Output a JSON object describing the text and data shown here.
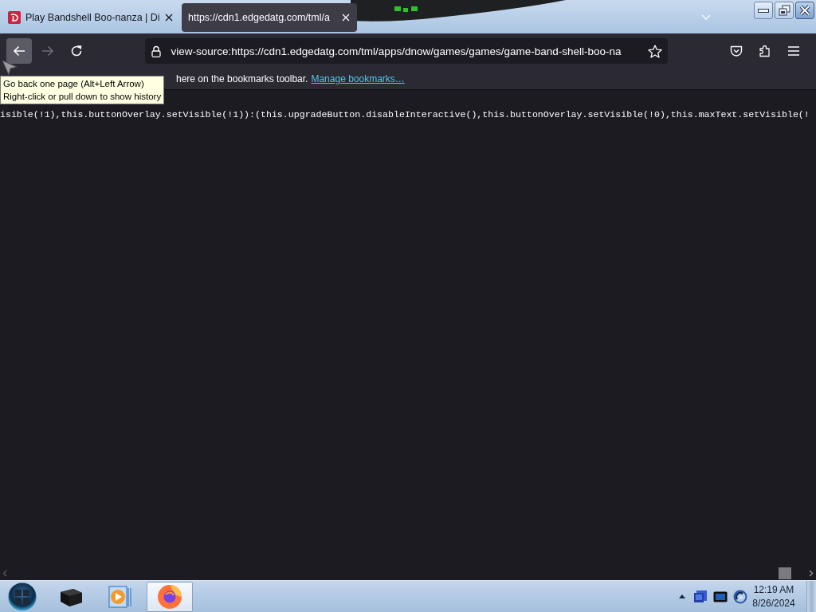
{
  "tabs": [
    {
      "title": "Play Bandshell Boo-nanza | Di",
      "selected": false,
      "kind": "favicon"
    },
    {
      "title": "https://cdn1.edgedatg.com/tml/a",
      "selected": true,
      "kind": "plain"
    }
  ],
  "toolbar": {
    "buttons": [
      {
        "kind": "back",
        "hovered": true,
        "disabled": false
      },
      {
        "kind": "forward",
        "hovered": false,
        "disabled": true
      },
      {
        "kind": "reload",
        "hovered": false,
        "disabled": false
      }
    ],
    "address": "view-source:https://cdn1.edgedatg.com/tml/apps/dnow/games/games/game-band-shell-boo-na"
  },
  "bookmarks_bar": {
    "text": "here on the bookmarks toolbar.",
    "link": "Manage bookmarks…"
  },
  "tooltip": {
    "lines": [
      "Go back one page (Alt+Left Arrow)",
      "Right-click or pull down to show history"
    ]
  },
  "source_line": "isible(!1),this.buttonOverlay.setVisible(!1)):(this.upgradeButton.disableInteractive(),this.buttonOverlay.setVisible(!0),this.maxText.setVisible(!",
  "taskbar": {
    "items": [
      {
        "kind": "box",
        "selected": false
      },
      {
        "kind": "media",
        "selected": false
      },
      {
        "kind": "browser",
        "selected": true
      }
    ],
    "clock": {
      "time": "12:19 AM",
      "date": "8/26/2024"
    }
  }
}
